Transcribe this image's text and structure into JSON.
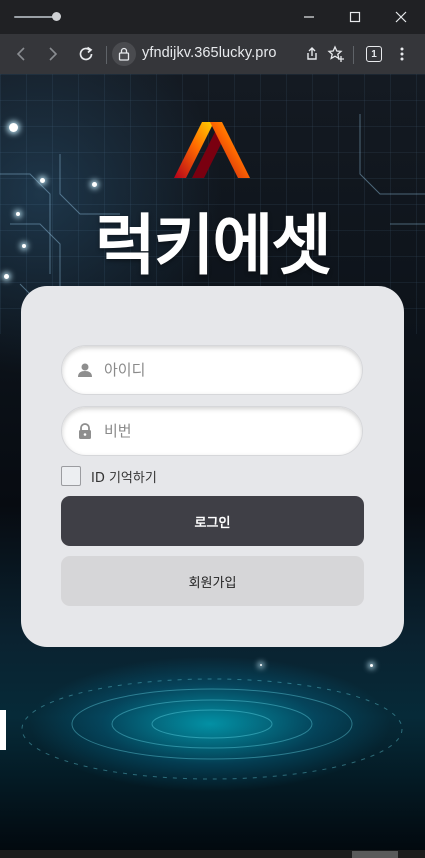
{
  "browser": {
    "url": "yfndijkv.365lucky.pro",
    "tab_count": "1"
  },
  "page": {
    "brand_name": "럭키에셋",
    "login_form": {
      "id_placeholder": "아이디",
      "password_placeholder": "비번",
      "remember_label": "ID 기억하기",
      "login_button": "로그인",
      "signup_button": "회원가입"
    }
  },
  "colors": {
    "card_bg": "#e6e7ea",
    "login_button_bg": "#3f3f46",
    "signup_button_bg": "#d6d6d8",
    "logo_gradient": [
      "#b3001b",
      "#ff6a00",
      "#ffd400"
    ]
  }
}
